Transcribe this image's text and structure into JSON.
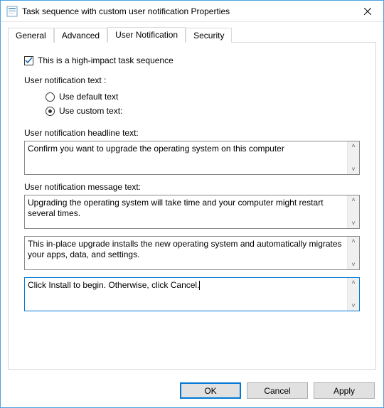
{
  "window": {
    "title": "Task sequence with custom user notification Properties"
  },
  "tabs": {
    "general": "General",
    "advanced": "Advanced",
    "user_notification": "User Notification",
    "security": "Security"
  },
  "panel": {
    "high_impact_label": "This is a high-impact task sequence",
    "high_impact_checked": true,
    "notification_text_label": "User notification text :",
    "radio_default": "Use default text",
    "radio_custom": "Use custom text:",
    "radio_selected": "custom",
    "headline_label": "User notification headline text:",
    "headline_value": "Confirm you want to upgrade the operating system on this computer",
    "message_label": "User notification message text:",
    "message1": "Upgrading the operating system will take time and your computer might restart several times.",
    "message2": "This in-place upgrade installs the new operating system and automatically migrates your apps, data, and settings.",
    "message3": "Click Install to begin. Otherwise, click Cancel."
  },
  "buttons": {
    "ok": "OK",
    "cancel": "Cancel",
    "apply": "Apply"
  }
}
